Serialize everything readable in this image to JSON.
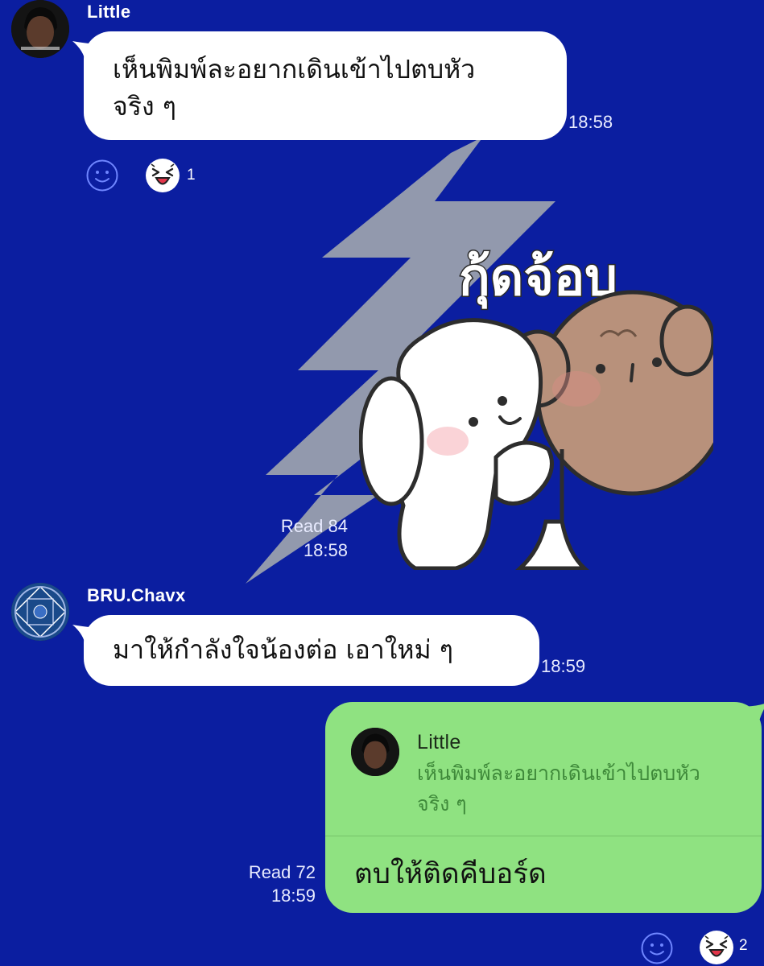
{
  "messages": [
    {
      "sender": "Little",
      "text_line1": "เห็นพิมพ์ละอยากเดินเข้าไปตบหัว",
      "text_line2": "จริง ๆ",
      "time": "18:58",
      "reaction_count": "1"
    },
    {
      "sticker_text": "กุ้ดจ้อบ",
      "read": "Read 84",
      "time": "18:58"
    },
    {
      "sender": "BRU.Chavx",
      "text": "มาให้กำลังใจน้องต่อ เอาใหม่ ๆ",
      "time": "18:59"
    }
  ],
  "my_reply": {
    "quote_name": "Little",
    "quote_line1": "เห็นพิมพ์ละอยากเดินเข้าไปตบหัว",
    "quote_line2": "จริง ๆ",
    "text": "ตบให้ติดคีบอร์ด",
    "read": "Read 72",
    "time": "18:59",
    "reaction_count": "2"
  },
  "colors": {
    "background": "#0b1ea0",
    "my_bubble": "#8fe281",
    "their_bubble": "#ffffff"
  },
  "icons": [
    "smile-reaction-icon",
    "laughing-face-icon",
    "lightning-bolt-background"
  ]
}
